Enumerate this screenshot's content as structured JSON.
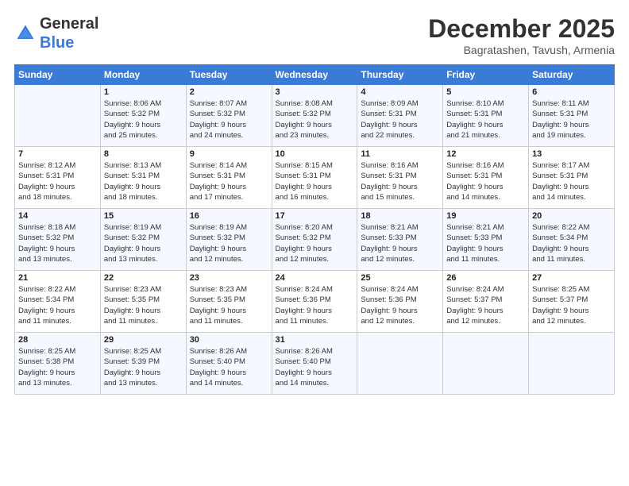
{
  "header": {
    "logo_line1": "General",
    "logo_line2": "Blue",
    "month_title": "December 2025",
    "subtitle": "Bagratashen, Tavush, Armenia"
  },
  "calendar": {
    "days_of_week": [
      "Sunday",
      "Monday",
      "Tuesday",
      "Wednesday",
      "Thursday",
      "Friday",
      "Saturday"
    ],
    "weeks": [
      [
        {
          "day": "",
          "info": ""
        },
        {
          "day": "1",
          "info": "Sunrise: 8:06 AM\nSunset: 5:32 PM\nDaylight: 9 hours\nand 25 minutes."
        },
        {
          "day": "2",
          "info": "Sunrise: 8:07 AM\nSunset: 5:32 PM\nDaylight: 9 hours\nand 24 minutes."
        },
        {
          "day": "3",
          "info": "Sunrise: 8:08 AM\nSunset: 5:32 PM\nDaylight: 9 hours\nand 23 minutes."
        },
        {
          "day": "4",
          "info": "Sunrise: 8:09 AM\nSunset: 5:31 PM\nDaylight: 9 hours\nand 22 minutes."
        },
        {
          "day": "5",
          "info": "Sunrise: 8:10 AM\nSunset: 5:31 PM\nDaylight: 9 hours\nand 21 minutes."
        },
        {
          "day": "6",
          "info": "Sunrise: 8:11 AM\nSunset: 5:31 PM\nDaylight: 9 hours\nand 19 minutes."
        }
      ],
      [
        {
          "day": "7",
          "info": "Sunrise: 8:12 AM\nSunset: 5:31 PM\nDaylight: 9 hours\nand 18 minutes."
        },
        {
          "day": "8",
          "info": "Sunrise: 8:13 AM\nSunset: 5:31 PM\nDaylight: 9 hours\nand 18 minutes."
        },
        {
          "day": "9",
          "info": "Sunrise: 8:14 AM\nSunset: 5:31 PM\nDaylight: 9 hours\nand 17 minutes."
        },
        {
          "day": "10",
          "info": "Sunrise: 8:15 AM\nSunset: 5:31 PM\nDaylight: 9 hours\nand 16 minutes."
        },
        {
          "day": "11",
          "info": "Sunrise: 8:16 AM\nSunset: 5:31 PM\nDaylight: 9 hours\nand 15 minutes."
        },
        {
          "day": "12",
          "info": "Sunrise: 8:16 AM\nSunset: 5:31 PM\nDaylight: 9 hours\nand 14 minutes."
        },
        {
          "day": "13",
          "info": "Sunrise: 8:17 AM\nSunset: 5:31 PM\nDaylight: 9 hours\nand 14 minutes."
        }
      ],
      [
        {
          "day": "14",
          "info": "Sunrise: 8:18 AM\nSunset: 5:32 PM\nDaylight: 9 hours\nand 13 minutes."
        },
        {
          "day": "15",
          "info": "Sunrise: 8:19 AM\nSunset: 5:32 PM\nDaylight: 9 hours\nand 13 minutes."
        },
        {
          "day": "16",
          "info": "Sunrise: 8:19 AM\nSunset: 5:32 PM\nDaylight: 9 hours\nand 12 minutes."
        },
        {
          "day": "17",
          "info": "Sunrise: 8:20 AM\nSunset: 5:32 PM\nDaylight: 9 hours\nand 12 minutes."
        },
        {
          "day": "18",
          "info": "Sunrise: 8:21 AM\nSunset: 5:33 PM\nDaylight: 9 hours\nand 12 minutes."
        },
        {
          "day": "19",
          "info": "Sunrise: 8:21 AM\nSunset: 5:33 PM\nDaylight: 9 hours\nand 11 minutes."
        },
        {
          "day": "20",
          "info": "Sunrise: 8:22 AM\nSunset: 5:34 PM\nDaylight: 9 hours\nand 11 minutes."
        }
      ],
      [
        {
          "day": "21",
          "info": "Sunrise: 8:22 AM\nSunset: 5:34 PM\nDaylight: 9 hours\nand 11 minutes."
        },
        {
          "day": "22",
          "info": "Sunrise: 8:23 AM\nSunset: 5:35 PM\nDaylight: 9 hours\nand 11 minutes."
        },
        {
          "day": "23",
          "info": "Sunrise: 8:23 AM\nSunset: 5:35 PM\nDaylight: 9 hours\nand 11 minutes."
        },
        {
          "day": "24",
          "info": "Sunrise: 8:24 AM\nSunset: 5:36 PM\nDaylight: 9 hours\nand 11 minutes."
        },
        {
          "day": "25",
          "info": "Sunrise: 8:24 AM\nSunset: 5:36 PM\nDaylight: 9 hours\nand 12 minutes."
        },
        {
          "day": "26",
          "info": "Sunrise: 8:24 AM\nSunset: 5:37 PM\nDaylight: 9 hours\nand 12 minutes."
        },
        {
          "day": "27",
          "info": "Sunrise: 8:25 AM\nSunset: 5:37 PM\nDaylight: 9 hours\nand 12 minutes."
        }
      ],
      [
        {
          "day": "28",
          "info": "Sunrise: 8:25 AM\nSunset: 5:38 PM\nDaylight: 9 hours\nand 13 minutes."
        },
        {
          "day": "29",
          "info": "Sunrise: 8:25 AM\nSunset: 5:39 PM\nDaylight: 9 hours\nand 13 minutes."
        },
        {
          "day": "30",
          "info": "Sunrise: 8:26 AM\nSunset: 5:40 PM\nDaylight: 9 hours\nand 14 minutes."
        },
        {
          "day": "31",
          "info": "Sunrise: 8:26 AM\nSunset: 5:40 PM\nDaylight: 9 hours\nand 14 minutes."
        },
        {
          "day": "",
          "info": ""
        },
        {
          "day": "",
          "info": ""
        },
        {
          "day": "",
          "info": ""
        }
      ]
    ]
  }
}
